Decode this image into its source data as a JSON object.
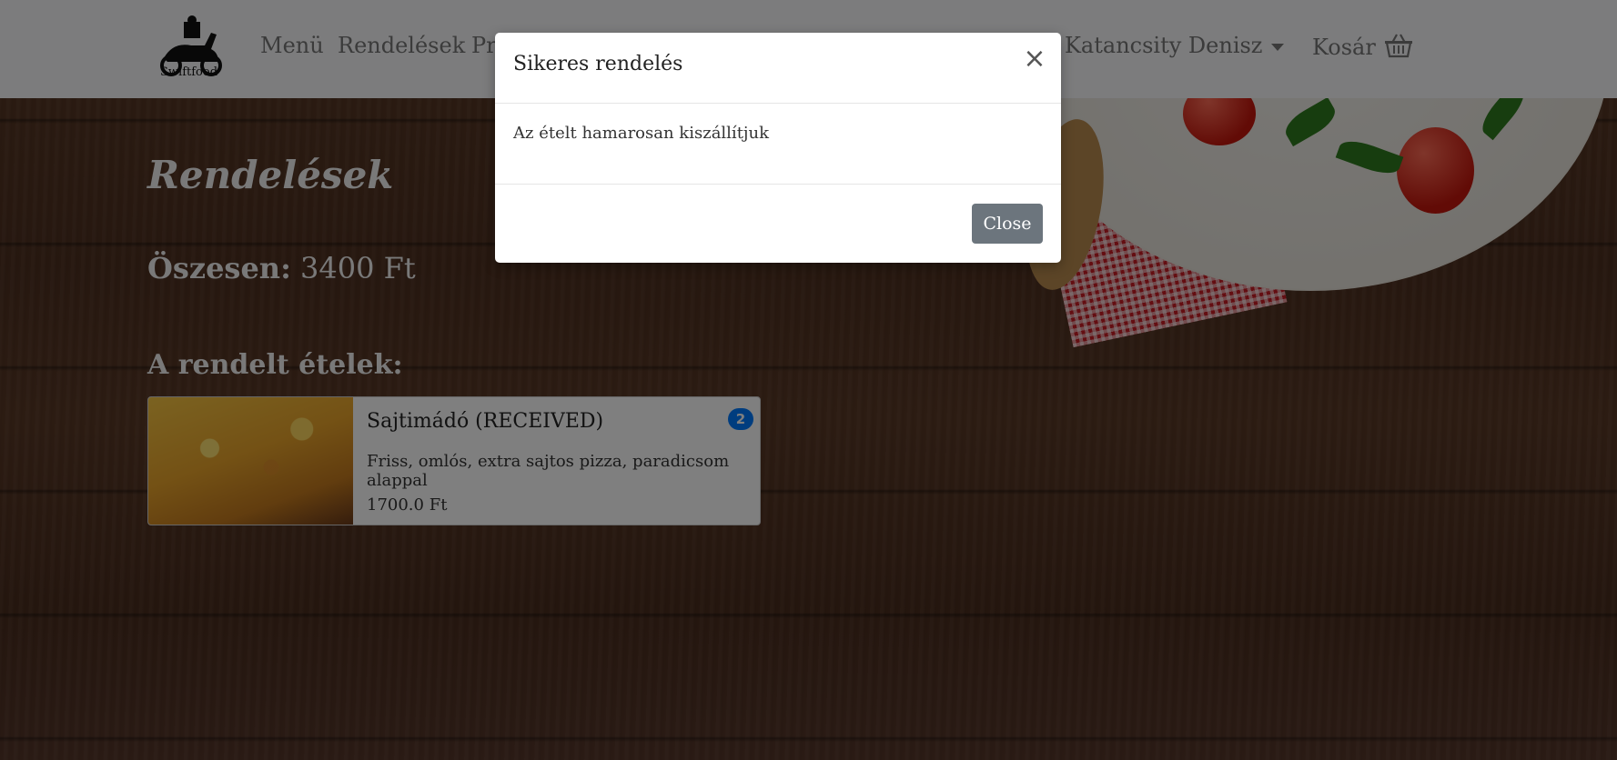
{
  "navbar": {
    "logo_text": "Swiftfood",
    "links": [
      "Menü",
      "Rendelések",
      "Pr"
    ],
    "user_name": "Katancsity Denisz",
    "cart_label": "Kosár"
  },
  "page": {
    "title": "Rendelések",
    "total_label": "Öszesen:",
    "total_value": "3400 Ft",
    "ordered_title": "A rendelt ételek:"
  },
  "order_item": {
    "name": "Sajtimádó (RECEIVED)",
    "description": "Friss, omlós, extra sajtos pizza, paradicsom alappal",
    "price": "1700.0 Ft",
    "quantity": "2"
  },
  "modal": {
    "title": "Sikeres rendelés",
    "close_symbol": "×",
    "body": "Az ételt hamarosan kiszállítjuk",
    "close_button": "Close"
  },
  "colors": {
    "navbar_bg": "#f8f9fa",
    "badge": "#007bff",
    "close_button": "#6c757d",
    "backdrop": "rgba(0,0,0,0.5)"
  }
}
